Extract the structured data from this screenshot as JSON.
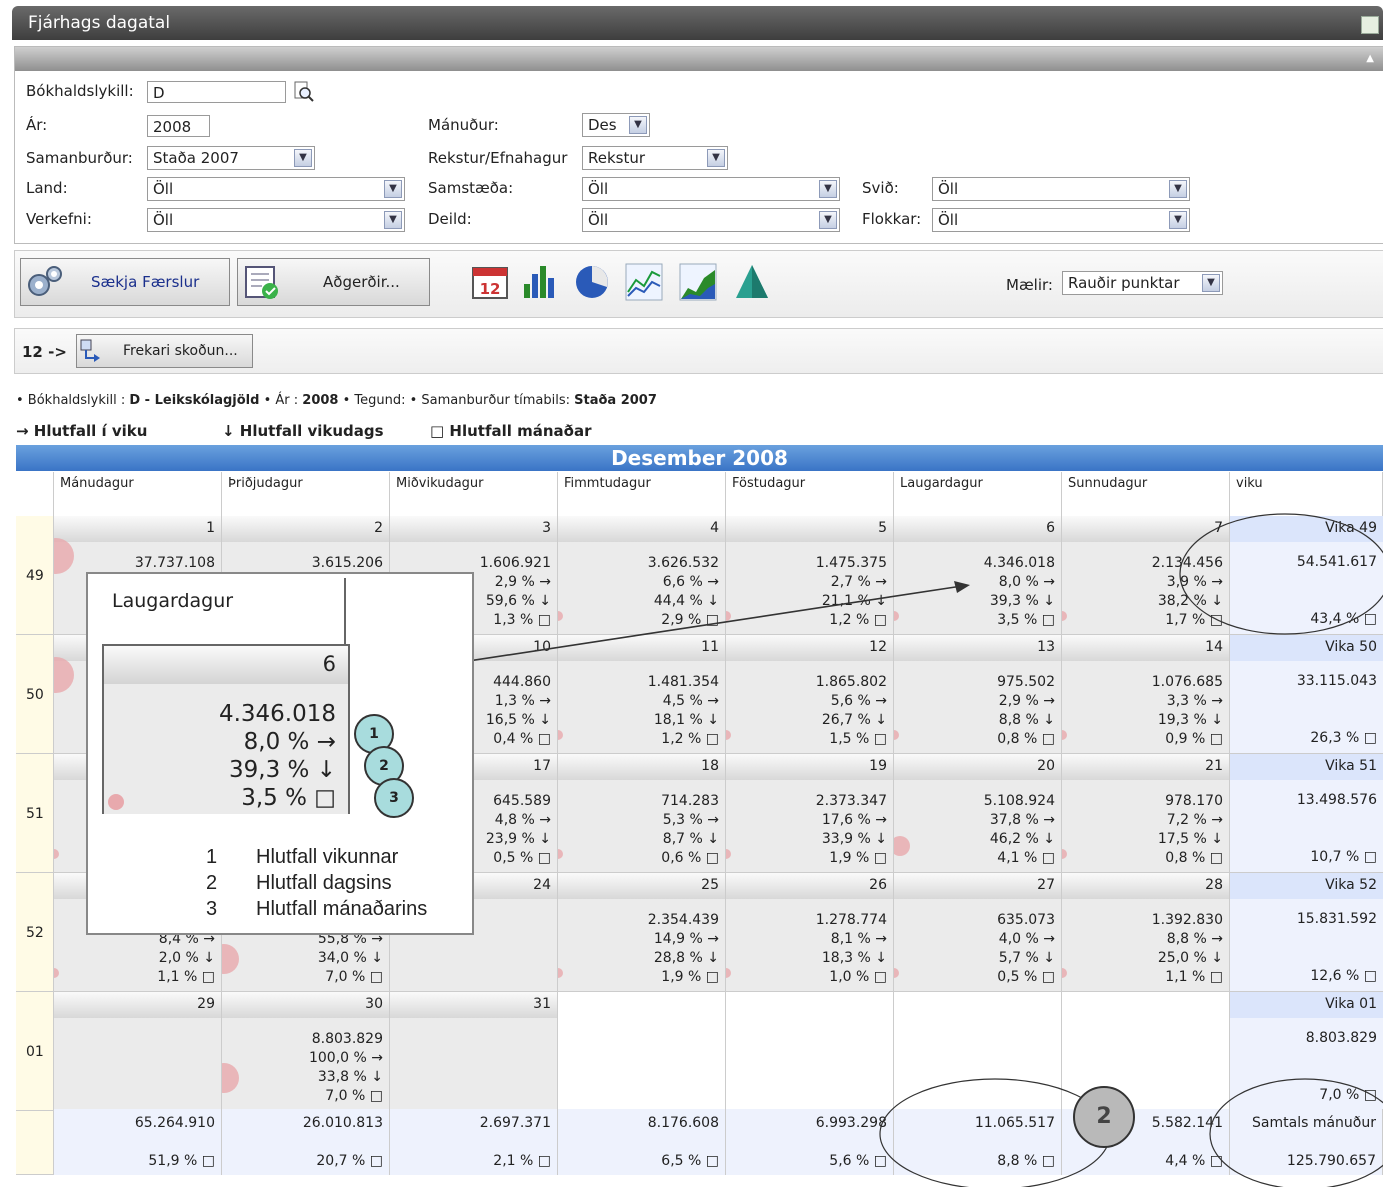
{
  "window": {
    "title": "Fjárhags dagatal"
  },
  "filters": {
    "bokhaldslykill_label": "Bókhaldslykill:",
    "bokhaldslykill_value": "D",
    "ar_label": "Ár:",
    "ar_value": "2008",
    "manudur_label": "Mánuður:",
    "manudur_value": "Des",
    "samanburdur_label": "Samanburður:",
    "samanburdur_value": "Staða 2007",
    "rekstur_label": "Rekstur/Efnahagur",
    "rekstur_value": "Rekstur",
    "land_label": "Land:",
    "land_value": "Öll",
    "samstaeda_label": "Samstæða:",
    "samstaeda_value": "Öll",
    "svid_label": "Svið:",
    "svid_value": "Öll",
    "verkefni_label": "Verkefni:",
    "verkefni_value": "Öll",
    "deild_label": "Deild:",
    "deild_value": "Öll",
    "flokkar_label": "Flokkar:",
    "flokkar_value": "Öll"
  },
  "toolbar": {
    "fetch_label": "Sækja Færslur",
    "actions_label": "Aðgerðir...",
    "icons": [
      "calendar-icon",
      "bar-chart-icon",
      "pie-chart-icon",
      "line-chart-icon",
      "area-chart-icon",
      "pyramid-chart-icon"
    ],
    "maelir_label": "Mælir:",
    "maelir_value": "Rauðir punktar"
  },
  "drill": {
    "count": "12 ->",
    "more_label": "Frekari skoðun..."
  },
  "breadcrumb": {
    "p1": "• Bókhaldslykill : ",
    "p2": "D - Leikskólagjöld",
    "p3": " • Ár : ",
    "p4": "2008",
    "p5": " • Tegund: • Samanburður tímabils: ",
    "p6": "Staða 2007"
  },
  "legend": {
    "week": "→ Hlutfall í viku",
    "weekday": "↓ Hlutfall vikudags",
    "month": "□ Hlutfall mánaðar"
  },
  "calendar": {
    "month_title": "Desember 2008",
    "day_headers": [
      "Mánudagur",
      "Þriðjudagur",
      "Miðvikudagur",
      "Fimmtudagur",
      "Föstudagur",
      "Laugardagur",
      "Sunnudagur",
      "viku"
    ],
    "weeks": [
      {
        "num": "49",
        "vika_label": "Vika 49",
        "vika_total": "54.541.617",
        "vika_pct": "43,4 % □",
        "days": [
          {
            "d": "1",
            "a": "37.737.108",
            "b": "",
            "c": "",
            "e": ""
          },
          {
            "d": "2",
            "a": "3.615.206",
            "b": "",
            "c": "",
            "e": ""
          },
          {
            "d": "3",
            "a": "1.606.921",
            "b": "2,9 % →",
            "c": "59,6 % ↓",
            "e": "1,3 % □"
          },
          {
            "d": "4",
            "a": "3.626.532",
            "b": "6,6 % →",
            "c": "44,4 % ↓",
            "e": "2,9 % □"
          },
          {
            "d": "5",
            "a": "1.475.375",
            "b": "2,7 % →",
            "c": "21,1 % ↓",
            "e": "1,2 % □"
          },
          {
            "d": "6",
            "a": "4.346.018",
            "b": "8,0 % →",
            "c": "39,3 % ↓",
            "e": "3,5 % □"
          },
          {
            "d": "7",
            "a": "2.134.456",
            "b": "3,9 % →",
            "c": "38,2 % ↓",
            "e": "1,7 % □"
          }
        ]
      },
      {
        "num": "50",
        "vika_label": "Vika 50",
        "vika_total": "33.115.043",
        "vika_pct": "26,3 % □",
        "days": [
          {
            "d": "",
            "a": "",
            "b": "",
            "c": "",
            "e": ""
          },
          {
            "d": "",
            "a": "",
            "b": "",
            "c": "",
            "e": ""
          },
          {
            "d": "10",
            "a": "444.860",
            "b": "1,3 % →",
            "c": "16,5 % ↓",
            "e": "0,4 % □"
          },
          {
            "d": "11",
            "a": "1.481.354",
            "b": "4,5 % →",
            "c": "18,1 % ↓",
            "e": "1,2 % □"
          },
          {
            "d": "12",
            "a": "1.865.802",
            "b": "5,6 % →",
            "c": "26,7 % ↓",
            "e": "1,5 % □"
          },
          {
            "d": "13",
            "a": "975.502",
            "b": "2,9 % →",
            "c": "8,8 % ↓",
            "e": "0,8 % □"
          },
          {
            "d": "14",
            "a": "1.076.685",
            "b": "3,3 % →",
            "c": "19,3 % ↓",
            "e": "0,9 % □"
          }
        ]
      },
      {
        "num": "51",
        "vika_label": "Vika 51",
        "vika_total": "13.498.576",
        "vika_pct": "10,7 % □",
        "days": [
          {
            "d": "",
            "a": "",
            "b": "",
            "c": "",
            "e": ""
          },
          {
            "d": "",
            "a": "",
            "b": "",
            "c": "",
            "e": ""
          },
          {
            "d": "17",
            "a": "645.589",
            "b": "4,8 % →",
            "c": "23,9 % ↓",
            "e": "0,5 % □"
          },
          {
            "d": "18",
            "a": "714.283",
            "b": "5,3 % →",
            "c": "8,7 % ↓",
            "e": "0,6 % □"
          },
          {
            "d": "19",
            "a": "2.373.347",
            "b": "17,6 % →",
            "c": "33,9 % ↓",
            "e": "1,9 % □"
          },
          {
            "d": "20",
            "a": "5.108.924",
            "b": "37,8 % →",
            "c": "46,2 % ↓",
            "e": "4,1 % □"
          },
          {
            "d": "21",
            "a": "978.170",
            "b": "7,2 % →",
            "c": "17,5 % ↓",
            "e": "0,8 % □"
          }
        ]
      },
      {
        "num": "52",
        "vika_label": "Vika 52",
        "vika_total": "15.831.592",
        "vika_pct": "12,6 % □",
        "days": [
          {
            "d": "",
            "a": "",
            "b": "8,4 % →",
            "c": "2,0 % ↓",
            "e": "1,1 % □"
          },
          {
            "d": "",
            "a": "",
            "b": "55,8 % →",
            "c": "34,0 % ↓",
            "e": "7,0 % □"
          },
          {
            "d": "24",
            "a": "",
            "b": "",
            "c": "",
            "e": ""
          },
          {
            "d": "25",
            "a": "2.354.439",
            "b": "14,9 % →",
            "c": "28,8 % ↓",
            "e": "1,9 % □"
          },
          {
            "d": "26",
            "a": "1.278.774",
            "b": "8,1 % →",
            "c": "18,3 % ↓",
            "e": "1,0 % □"
          },
          {
            "d": "27",
            "a": "635.073",
            "b": "4,0 % →",
            "c": "5,7 % ↓",
            "e": "0,5 % □"
          },
          {
            "d": "28",
            "a": "1.392.830",
            "b": "8,8 % →",
            "c": "25,0 % ↓",
            "e": "1,1 % □"
          }
        ]
      },
      {
        "num": "01",
        "vika_label": "Vika 01",
        "vika_total": "8.803.829",
        "vika_pct": "7,0 % □",
        "days": [
          {
            "d": "29",
            "a": "",
            "b": "",
            "c": "",
            "e": ""
          },
          {
            "d": "30",
            "a": "8.803.829",
            "b": "100,0 % →",
            "c": "33,8 % ↓",
            "e": "7,0 % □"
          },
          {
            "d": "31",
            "a": "",
            "b": "",
            "c": "",
            "e": ""
          }
        ]
      }
    ],
    "totals": [
      {
        "a": "65.264.910",
        "b": "51,9 % □"
      },
      {
        "a": "26.010.813",
        "b": "20,7 % □"
      },
      {
        "a": "2.697.371",
        "b": "2,1 % □"
      },
      {
        "a": "8.176.608",
        "b": "6,5 % □"
      },
      {
        "a": "6.993.298",
        "b": "5,6 % □"
      },
      {
        "a": "11.065.517",
        "b": "8,8 % □"
      },
      {
        "a": "5.582.141",
        "b": "4,4 % □"
      }
    ],
    "month_total_label": "Samtals mánuður",
    "month_total": "125.790.657"
  },
  "annotation": {
    "day_name": "Laugardagur",
    "day_num": "6",
    "value": "4.346.018",
    "p1": "8,0 % →",
    "p2": "39,3 % ↓",
    "p3": "3,5 % □",
    "n1": "1",
    "n2": "2",
    "n3": "3",
    "legend": [
      {
        "n": "1",
        "t": "Hlutfall vikunnar"
      },
      {
        "n": "2",
        "t": "Hlutfall dagsins"
      },
      {
        "n": "3",
        "t": "Hlutfall mánaðarins"
      }
    ],
    "big_marker": "2"
  }
}
